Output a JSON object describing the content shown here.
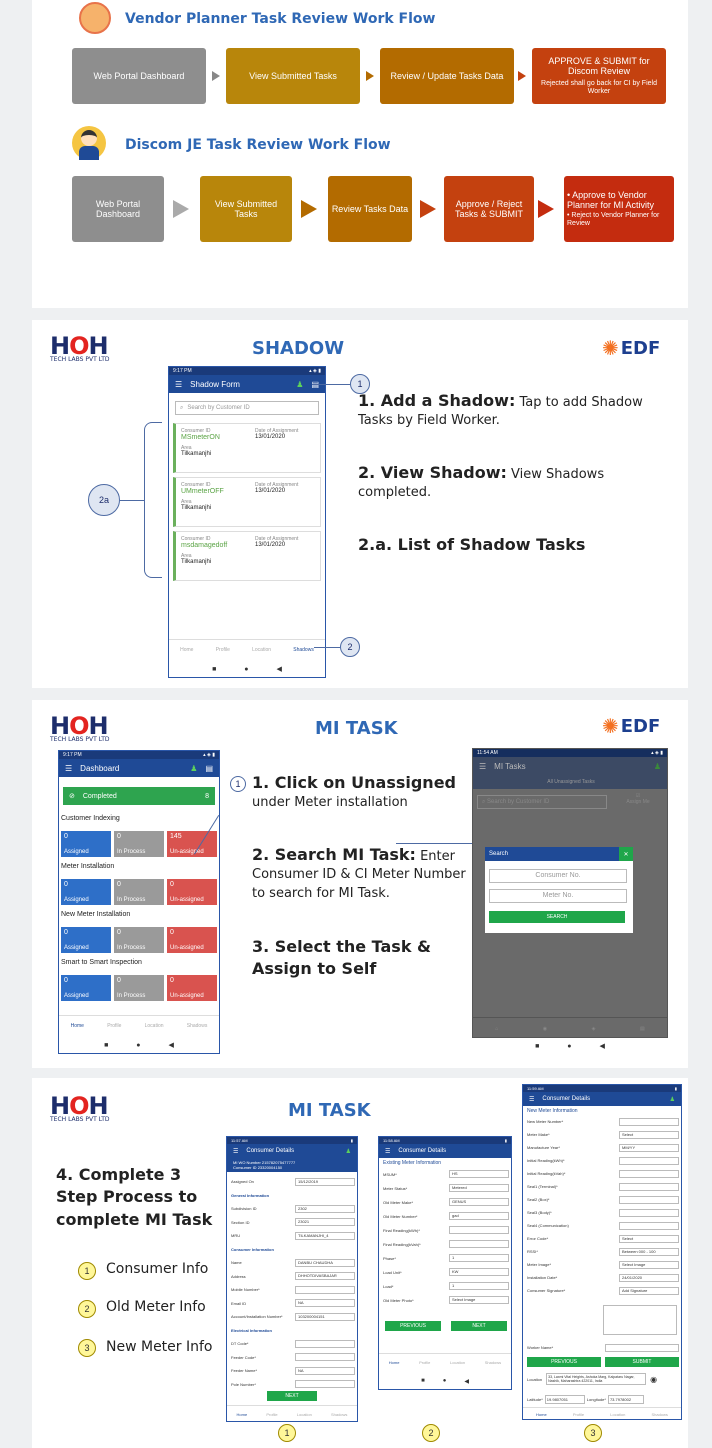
{
  "vendor_workflow": {
    "title": "Vendor Planner Task Review Work Flow",
    "steps": [
      {
        "label": "Web Portal Dashboard",
        "color": "#8e8e8e"
      },
      {
        "label": "View Submitted Tasks",
        "color": "#b8860b"
      },
      {
        "label": "Review / Update Tasks Data",
        "color": "#b36b00"
      },
      {
        "label": "APPROVE & SUBMIT for Discom Review",
        "sub": "Rejected shall go back for CI by Field Worker",
        "color": "#c4410f"
      }
    ]
  },
  "discom_workflow": {
    "title": "Discom JE Task Review Work Flow",
    "steps": [
      {
        "label": "Web Portal Dashboard",
        "color": "#8e8e8e"
      },
      {
        "label": "View Submitted Tasks",
        "color": "#b8860b"
      },
      {
        "label": "Review Tasks Data",
        "color": "#b36b00"
      },
      {
        "label": "Approve / Reject Tasks & SUBMIT",
        "color": "#c4410f"
      },
      {
        "label": "• Approve to Vendor Planner for MI Activity",
        "sub": "• Reject to Vendor Planner for Review",
        "color": "#c42c0f"
      }
    ]
  },
  "brand": {
    "logo_main": "HOH",
    "logo_sub": "TECH LABS PVT LTD",
    "partner": "EDF"
  },
  "shadow": {
    "title": "SHADOW",
    "phone": {
      "time": "9:17 PM",
      "appbar_title": "Shadow Form",
      "search_placeholder": "Search by Customer ID",
      "cards": [
        {
          "cid_label": "Consumer ID",
          "cid": "MSmeterON",
          "date_label": "Date of Assignment",
          "date": "13/01/2020",
          "area_label": "Area",
          "area": "Tilkamanjhi"
        },
        {
          "cid_label": "Consumer ID",
          "cid": "UMmeterOFF",
          "date_label": "Date of Assignment",
          "date": "13/01/2020",
          "area_label": "Area",
          "area": "Tilkamanjhi"
        },
        {
          "cid_label": "Consumer ID",
          "cid": "msdamagedoff",
          "date_label": "Date of Assignment",
          "date": "13/01/2020",
          "area_label": "Area",
          "area": "Tilkamanjhi"
        }
      ],
      "nav": [
        "Home",
        "Profile",
        "Location",
        "Shadows"
      ]
    },
    "callouts": [
      "1",
      "2",
      "2a"
    ],
    "steps": [
      {
        "bold": "1. Add a Shadow:",
        "text": " Tap to add Shadow Tasks by Field Worker."
      },
      {
        "bold": "2. View Shadow:",
        "text": " View Shadows completed."
      },
      {
        "bold": "2.a. List of Shadow Tasks",
        "text": ""
      }
    ]
  },
  "mi_task": {
    "title": "MI TASK",
    "dashboard": {
      "time": "9:17 PM",
      "appbar_title": "Dashboard",
      "completed_label": "Completed",
      "completed_count": "8",
      "sections": [
        {
          "name": "Customer Indexing",
          "values": [
            "0",
            "0",
            "145"
          ]
        },
        {
          "name": "Meter Installation",
          "values": [
            "0",
            "0",
            "0"
          ]
        },
        {
          "name": "New Meter Installation",
          "values": [
            "0",
            "0",
            "0"
          ]
        },
        {
          "name": "Smart to Smart Inspection",
          "values": [
            "0",
            "0",
            "0"
          ]
        }
      ],
      "tile_labels": [
        "Assigned",
        "In Process",
        "Un-assigned"
      ],
      "nav": [
        "Home",
        "Profile",
        "Location",
        "Shadows"
      ]
    },
    "search_phone": {
      "time": "11:54 AM",
      "appbar_title": "MI Tasks",
      "tab": "All Unassigned Tasks",
      "search_placeholder": "Search by Customer ID",
      "assign_label": "Assign Me",
      "dialog_title": "Search",
      "consumer_placeholder": "Consumer No.",
      "meter_placeholder": "Meter No.",
      "search_button": "SEARCH"
    },
    "steps": [
      {
        "bold": "1. Click on Unassigned",
        "text": "under Meter installation"
      },
      {
        "bold": "2. Search MI Task:",
        "text": " Enter Consumer ID & CI Meter Number to search for MI Task."
      },
      {
        "bold": "3. Select the Task & Assign to Self",
        "text": ""
      }
    ]
  },
  "mi_task2": {
    "title": "MI TASK",
    "heading": "4. Complete 3 Step Process to complete MI Task",
    "items": [
      "Consumer Info",
      "Old Meter Info",
      "New Meter Info"
    ],
    "screen1": {
      "time": "11:57 AM",
      "title": "Consumer Details",
      "mi_wo_label": "MI WO Number",
      "mi_wo": "215782075477777",
      "cid_label": "Consumer ID",
      "cid": "23320004150",
      "rows": [
        [
          "Assigned On",
          "15/12/2019"
        ],
        [
          "General Information",
          ""
        ],
        [
          "Subdivision ID",
          "2302"
        ],
        [
          "Section ID",
          "23021"
        ],
        [
          "MRU",
          "TILKAMANJHI_4"
        ],
        [
          "Consumer Information",
          ""
        ],
        [
          "Name",
          "DANBU CHAUDHA"
        ],
        [
          "Address",
          "DHHOTDIVASBAJAR"
        ],
        [
          "Mobile Number*",
          ""
        ],
        [
          "Email ID",
          "NA"
        ],
        [
          "Account/Installation Number*",
          "103200004151"
        ],
        [
          "Electrical Information",
          ""
        ],
        [
          "DT Code*",
          ""
        ],
        [
          "Feeder Code*",
          ""
        ],
        [
          "Feeder Name*",
          "NA"
        ],
        [
          "Pole Number*",
          ""
        ]
      ],
      "button": "NEXT",
      "nav": [
        "Home",
        "Profile",
        "Location",
        "Shadows"
      ]
    },
    "screen2": {
      "time": "11:58 AM",
      "title": "Consumer Details",
      "section": "Existing Meter Information",
      "rows": [
        [
          "MSUM*",
          "HS"
        ],
        [
          "Meter Status*",
          "Metered"
        ],
        [
          "Old Meter Make*",
          "GENUS"
        ],
        [
          "Old Meter Number*",
          "gad"
        ],
        [
          "Final Reading(kWh)*",
          ""
        ],
        [
          "Final Reading(kVah)*",
          ""
        ],
        [
          "Phase*",
          "1"
        ],
        [
          "Load Unit*",
          "KW"
        ],
        [
          "Load*",
          "1"
        ],
        [
          "Old Meter Photo*",
          "Select Image"
        ]
      ],
      "prev": "PREVIOUS",
      "next": "NEXT",
      "nav": [
        "Home",
        "Profile",
        "Location",
        "Shadows"
      ]
    },
    "screen3": {
      "time": "11:59 AM",
      "title": "Consumer Details",
      "section": "New Meter Information",
      "rows": [
        [
          "New Meter Number*",
          ""
        ],
        [
          "Meter Make*",
          "Select"
        ],
        [
          "Manufacture Year*",
          "MM/YY"
        ],
        [
          "Initial Reading(kWh)*",
          ""
        ],
        [
          "Initial Reading(kVah)*",
          ""
        ],
        [
          "Seal1 (Terminal)*",
          ""
        ],
        [
          "Seal2 (Box)*",
          ""
        ],
        [
          "Seal3 (Body)*",
          ""
        ],
        [
          "Seal4 (Communication)",
          ""
        ],
        [
          "Error Code*",
          "Select"
        ],
        [
          "RSSI*",
          "Between 000 - 100"
        ],
        [
          "Meter Image*",
          "Select Image"
        ],
        [
          "Installation Date*",
          "24/01/2020"
        ],
        [
          "Consumer Signature*",
          "Add Signature"
        ]
      ],
      "worker_label": "Worker Name*",
      "prev": "PREVIOUS",
      "submit": "SUBMIT",
      "location_label": "Location",
      "location": "33, Laxmi Vital Heights, Ashoka Marg, Kalpataru Nagar, Nashik, Maharashtra 422011, India",
      "lat_label": "Latitude*",
      "lat": "19.9807051",
      "lng_label": "Longitude*",
      "lng": "73.7978002",
      "nav": [
        "Home",
        "Profile",
        "Location",
        "Shadows"
      ]
    },
    "markers": [
      "1",
      "2",
      "3"
    ]
  }
}
